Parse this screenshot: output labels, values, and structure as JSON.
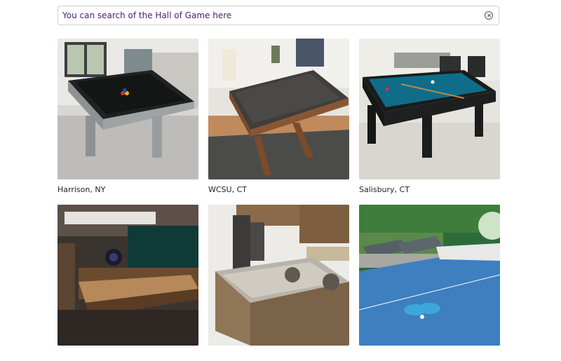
{
  "search": {
    "placeholder": "You can search of the Hall of Game here",
    "clear_icon": "clear-circle-x-icon"
  },
  "gallery": {
    "items": [
      {
        "caption": "Harrison, NY",
        "image": "pool-table-gray-black-felt"
      },
      {
        "caption": "WCSU, CT",
        "image": "pool-table-wood-gray-felt"
      },
      {
        "caption": "Salisbury, CT",
        "image": "pool-table-black-blue-felt"
      },
      {
        "caption": "",
        "image": "shuffleboard-game-room"
      },
      {
        "caption": "",
        "image": "kitchen-island-marble"
      },
      {
        "caption": "",
        "image": "outdoor-ping-pong-table"
      }
    ]
  },
  "colors": {
    "search_text": "#4b1d6b",
    "border": "#cfcfcf"
  }
}
